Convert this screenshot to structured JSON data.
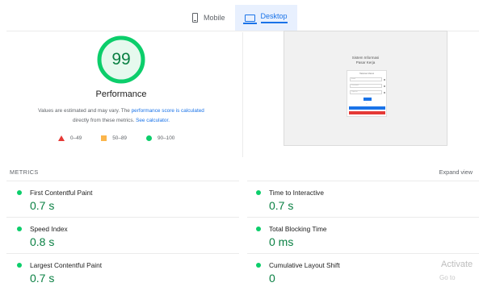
{
  "tabs": [
    {
      "label": "Mobile",
      "icon": "phone-icon"
    },
    {
      "label": "Desktop",
      "icon": "desktop-icon",
      "active": true
    }
  ],
  "performance": {
    "score": "99",
    "score_fraction": 0.99,
    "title": "Performance",
    "note_prefix": "Values are estimated and may vary. The ",
    "note_link1": "performance score is calculated",
    "note_middle": " directly from these metrics. ",
    "note_link2": "See calculator."
  },
  "legend": [
    {
      "range": "0–49",
      "shape": "triangle",
      "color": "#e53935"
    },
    {
      "range": "50–89",
      "shape": "square",
      "color": "#fbb54b"
    },
    {
      "range": "90–100",
      "shape": "circle",
      "color": "#0cce6b"
    }
  ],
  "thumbnail": {
    "title_line1": "Sistem Informasi",
    "title_line2": "Pasar Kerja",
    "card_title": "Halaman Masuk",
    "fields": [
      "Email",
      "Password",
      "Captcha"
    ]
  },
  "metrics": {
    "heading": "METRICS",
    "expand_label": "Expand view",
    "items": [
      {
        "label": "First Contentful Paint",
        "value": "0.7 s"
      },
      {
        "label": "Time to Interactive",
        "value": "0.7 s"
      },
      {
        "label": "Speed Index",
        "value": "0.8 s"
      },
      {
        "label": "Total Blocking Time",
        "value": "0 ms"
      },
      {
        "label": "Largest Contentful Paint",
        "value": "0.7 s"
      },
      {
        "label": "Cumulative Layout Shift",
        "value": "0"
      }
    ]
  },
  "colors": {
    "good": "#0cce6b",
    "good_text": "#0a8043",
    "accent": "#1a73e8"
  },
  "watermark": {
    "line1": "Activate",
    "line2": "Go to"
  }
}
